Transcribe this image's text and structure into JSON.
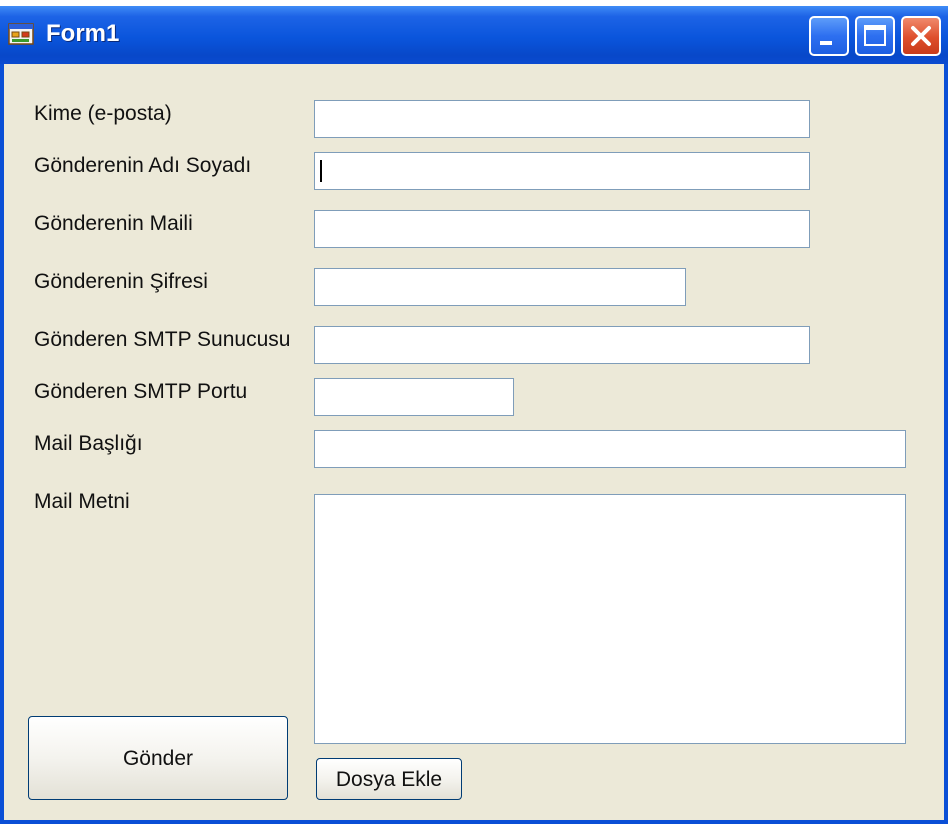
{
  "window": {
    "title": "Form1",
    "icon": "form-app-icon",
    "controls": [
      "minimize-icon",
      "maximize-icon",
      "close-icon"
    ]
  },
  "form": {
    "fields": [
      {
        "label": "Kime (e-posta)",
        "value": ""
      },
      {
        "label": "Gönderenin Adı Soyadı",
        "value": ""
      },
      {
        "label": "Gönderenin Maili",
        "value": ""
      },
      {
        "label": "Gönderenin Şifresi",
        "value": ""
      },
      {
        "label": "Gönderen SMTP Sunucusu",
        "value": ""
      },
      {
        "label": "Gönderen SMTP Portu",
        "value": ""
      },
      {
        "label": "Mail Başlığı",
        "value": ""
      },
      {
        "label": "Mail Metni",
        "value": ""
      }
    ],
    "send_label": "Gönder",
    "attach_label": "Dosya Ekle"
  },
  "colors": {
    "titlebar": "#0a55dc",
    "client_bg": "#ece9d8",
    "input_border": "#7f9db9",
    "close_button": "#de4e2c"
  }
}
